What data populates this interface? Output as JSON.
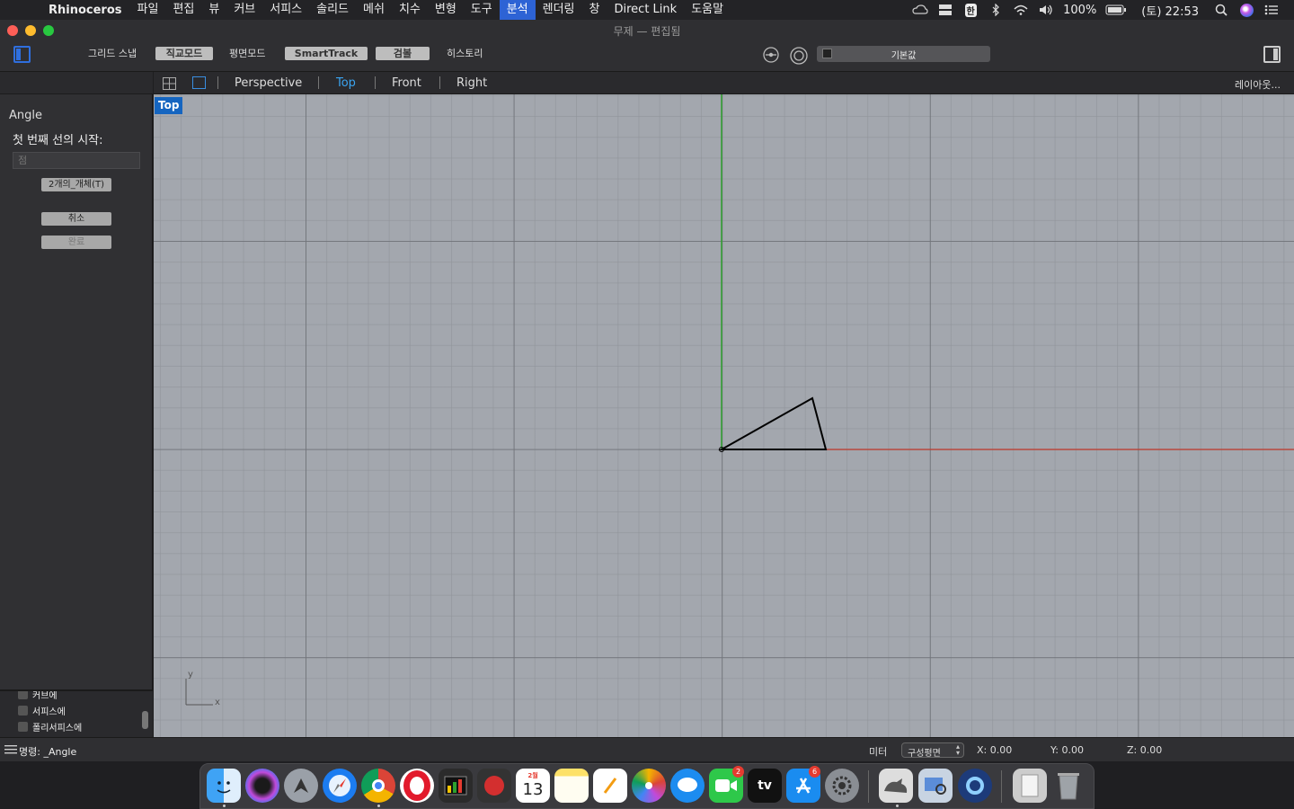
{
  "menubar": {
    "app_name": "Rhinoceros",
    "items": [
      "파일",
      "편집",
      "뷰",
      "커브",
      "서피스",
      "솔리드",
      "메쉬",
      "치수",
      "변형",
      "도구",
      "분석",
      "렌더링",
      "창",
      "Direct Link",
      "도움말"
    ],
    "active_index": 10,
    "battery": "100%",
    "ime": "한",
    "clock": "(토) 22:53"
  },
  "window": {
    "title": "무제 — 편집됨"
  },
  "toolbar": {
    "grid_snap": "그리드 스냅",
    "ortho": "직교모드",
    "planar": "평면모드",
    "smarttrack": "SmartTrack",
    "gumball": "검볼",
    "history": "히스토리",
    "layer_default": "기본값"
  },
  "command_panel": {
    "command_name": "Angle",
    "prompt": "첫 번째 선의 시작:",
    "point_placeholder": "점",
    "option_two_objects": "2개의_개체(T)",
    "cancel": "취소",
    "done": "완료"
  },
  "filter_list": {
    "items": [
      "커브에",
      "서피스에",
      "폴리서피스에"
    ]
  },
  "viewport_tabs": {
    "tabs": [
      "Perspective",
      "Top",
      "Front",
      "Right"
    ],
    "active_index": 1,
    "layout_button": "레이아웃..."
  },
  "viewport": {
    "label": "Top",
    "axis_x": "x",
    "axis_y": "y",
    "colors": {
      "x_axis": "#c0392b",
      "y_axis": "#2ea02e",
      "background": "#a3a7ae"
    }
  },
  "statusbar": {
    "command_line": "명령: _Angle",
    "units": "미터",
    "cplane": "구성평면",
    "x": "X: 0.00",
    "y": "Y: 0.00",
    "z": "Z: 0.00"
  },
  "dock": {
    "calendar_month": "2월",
    "calendar_day": "13",
    "tv_label": "tv",
    "facetime_badge": "2",
    "appstore_badge": "6"
  }
}
